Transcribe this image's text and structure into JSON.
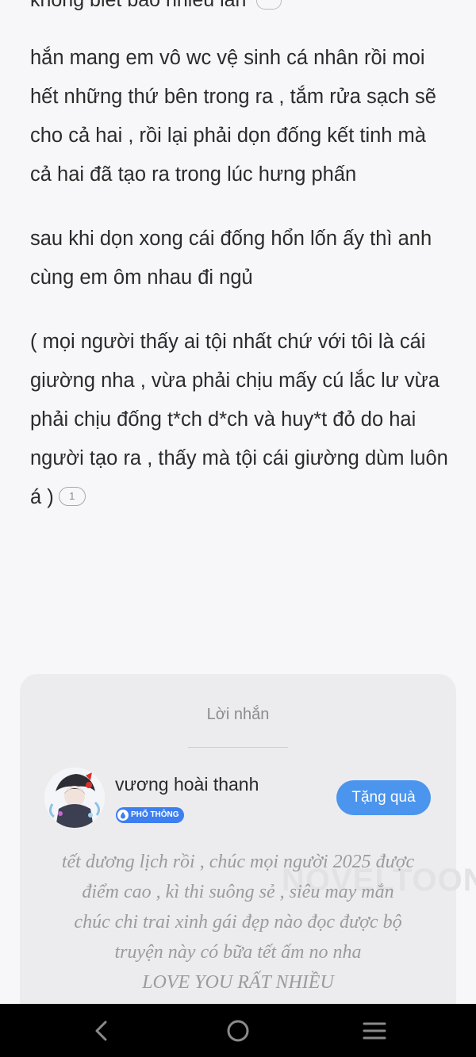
{
  "top_fragment": "không biết bao nhiêu lần",
  "paragraphs": [
    "hắn mang em vô wc vệ sinh cá nhân rồi moi hết những thứ bên trong ra , tắm rửa sạch sẽ cho cả hai , rồi lại phải dọn đống kết tinh mà cả hai đã tạo ra trong lúc hưng phấn",
    "sau khi dọn xong cái đống hổn lốn ấy thì anh cùng em ôm nhau đi ngủ",
    "( mọi người thấy ai tội nhất chứ với tôi là cái giường nha , vừa phải chịu mấy cú lắc lư vừa phải chịu đống t*ch d*ch và huy*t đỏ do hai người tạo ra , thấy mà tội cái giường dùm luôn á )"
  ],
  "comment_count": "1",
  "note_card": {
    "title": "Lời nhắn",
    "author_name": "vương hoài thanh",
    "badge": "PHỔ THÔNG",
    "gift_button": "Tặng quà",
    "message_lines": [
      "tết dương lịch rồi , chúc mọi người 2025 được",
      "điểm cao , kì thi suông sẻ , siêu may mắn",
      "chúc chi trai xinh gái đẹp nào đọc được bộ",
      "truyện này có bữa tết ấm no nha",
      "LOVE YOU RẤT NHIỀU"
    ],
    "watermark": "NOVELTOON"
  },
  "colors": {
    "background": "#f7f7f9",
    "card": "#ececee",
    "accent_button": "#4b95ee",
    "badge": "#3d7ff0",
    "nav_bar": "#000000"
  },
  "nav": {
    "back_icon": "chevron-left-icon",
    "home_icon": "circle-home-icon",
    "recents_icon": "menu-lines-icon"
  }
}
